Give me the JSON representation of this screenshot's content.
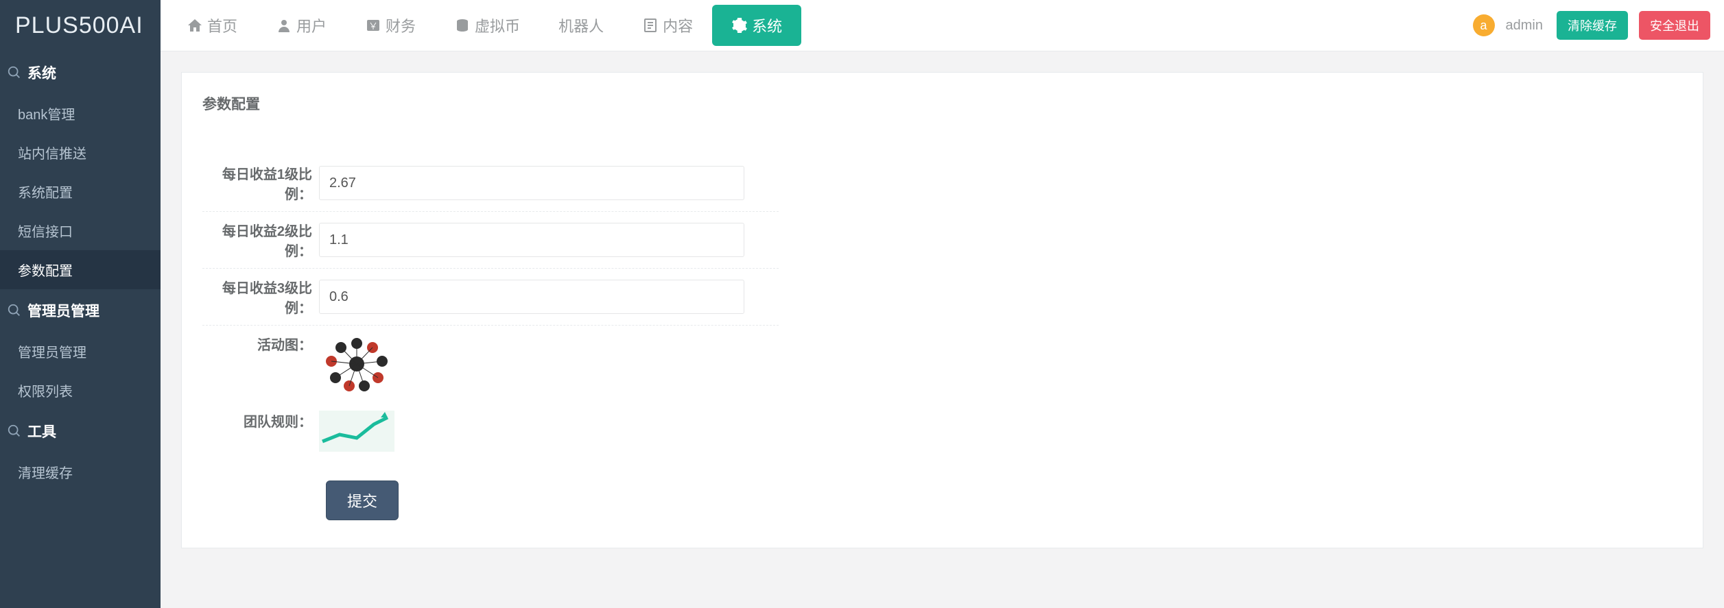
{
  "brand": "PLUS500AI",
  "sidebar": {
    "sections": [
      {
        "title": "系统",
        "items": [
          "bank管理",
          "站内信推送",
          "系统配置",
          "短信接口",
          "参数配置"
        ],
        "active_item_index": 4
      },
      {
        "title": "管理员管理",
        "items": [
          "管理员管理",
          "权限列表"
        ]
      },
      {
        "title": "工具",
        "items": [
          "清理缓存"
        ]
      }
    ]
  },
  "topnav": {
    "items": [
      {
        "label": "首页",
        "icon": "home"
      },
      {
        "label": "用户",
        "icon": "user"
      },
      {
        "label": "财务",
        "icon": "money"
      },
      {
        "label": "虚拟币",
        "icon": "db"
      },
      {
        "label": "机器人",
        "icon": ""
      },
      {
        "label": "内容",
        "icon": "doc"
      },
      {
        "label": "系统",
        "icon": "gear",
        "active": true
      }
    ]
  },
  "topbar": {
    "avatar_letter": "a",
    "username": "admin",
    "btn_clear_cache": "清除缓存",
    "btn_logout": "安全退出"
  },
  "panel": {
    "title": "参数配置",
    "fields": {
      "ratio1_label": "每日收益1级比例：",
      "ratio1_value": "2.67",
      "ratio2_label": "每日收益2级比例：",
      "ratio2_value": "1.1",
      "ratio3_label": "每日收益3级比例：",
      "ratio3_value": "0.6",
      "activity_img_label": "活动图：",
      "team_rule_label": "团队规则："
    },
    "submit_label": "提交"
  }
}
